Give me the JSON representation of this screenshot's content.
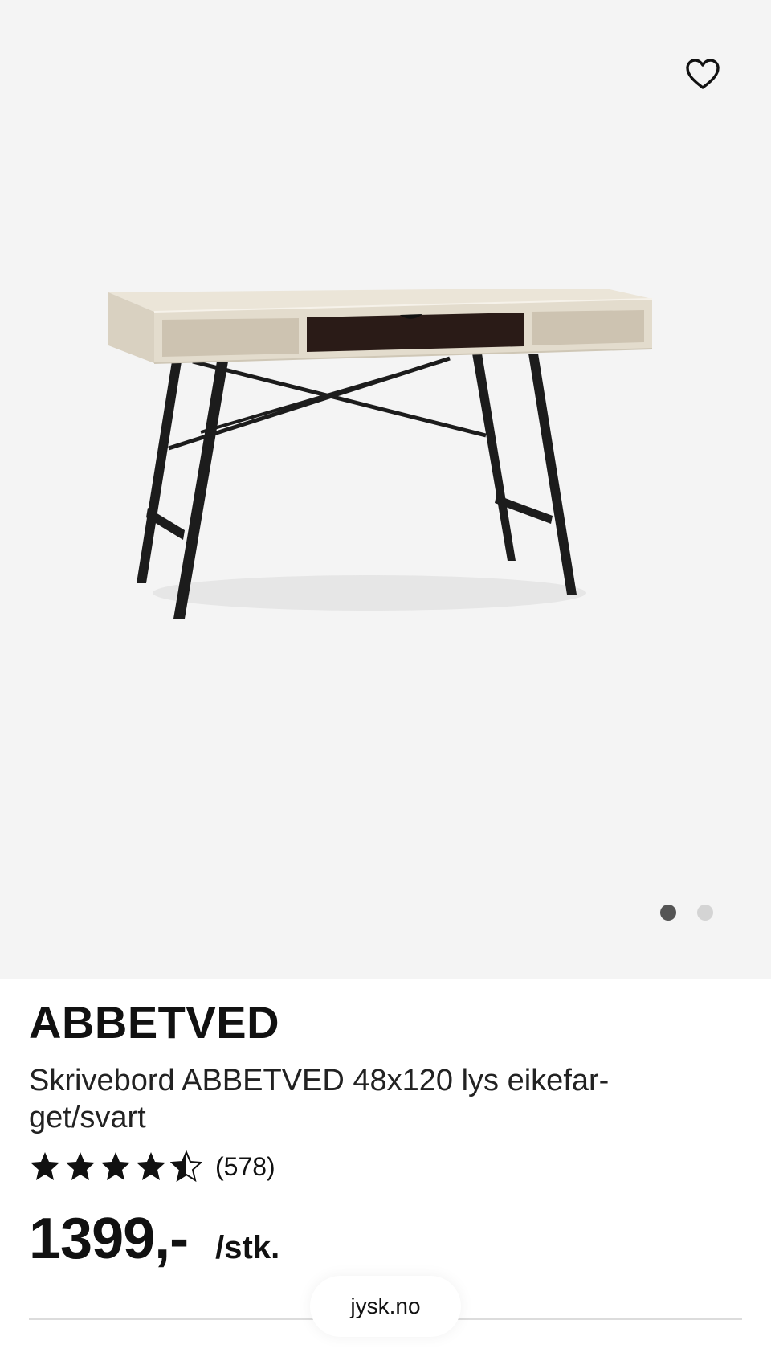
{
  "product": {
    "brand": "ABBETVED",
    "description": "Skrivebord ABBETVED 48x120 lys eikefar-get/svart",
    "rating_value": 4.5,
    "rating_max": 5,
    "review_count": "(578)",
    "price": "1399,-",
    "unit": "/stk."
  },
  "gallery": {
    "image_count": 2,
    "active_index": 0,
    "favorite_icon": "heart-outline-icon"
  },
  "browser": {
    "url": "jysk.no"
  },
  "colors": {
    "gallery_bg": "#f4f4f4",
    "desk_top": "#e3dccd",
    "drawer": "#2a1b17",
    "legs": "#1c1c1c",
    "dot_active": "#555555",
    "dot_inactive": "#d4d4d4"
  }
}
